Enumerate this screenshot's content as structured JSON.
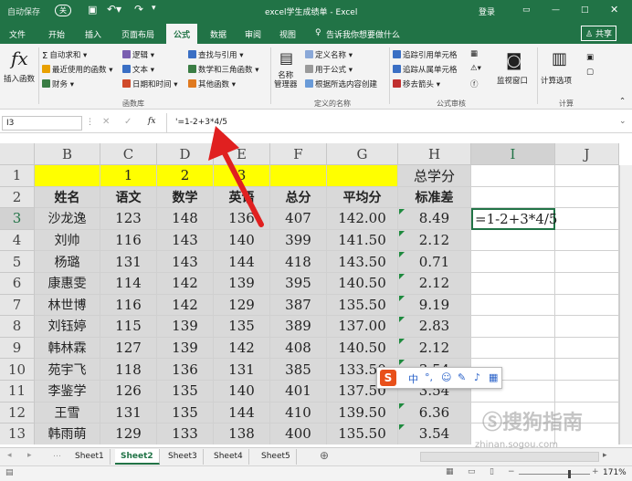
{
  "titlebar": {
    "autosave": "自动保存",
    "autosave_state": "关",
    "title": "excel学生成绩单 - Excel",
    "login": "登录"
  },
  "tabs": [
    "文件",
    "开始",
    "插入",
    "页面布局",
    "公式",
    "数据",
    "审阅",
    "视图"
  ],
  "active_tab_index": 4,
  "tell_me": "告诉我你想要做什么",
  "share": "共享",
  "ribbon": {
    "insert_function": "插入函数",
    "autosum": "自动求和",
    "recent": "最近使用的函数",
    "financial": "财务",
    "logical": "逻辑",
    "text": "文本",
    "datetime": "日期和时间",
    "lookup": "查找与引用",
    "math": "数学和三角函数",
    "other": "其他函数",
    "function_library": "函数库",
    "name_manager": "名称\n管理器",
    "define_name": "定义名称",
    "use_in_formula": "用于公式",
    "create_from_selection": "根据所选内容创建",
    "defined_names": "定义的名称",
    "trace_precedents": "追踪引用单元格",
    "trace_dependents": "追踪从属单元格",
    "remove_arrows": "移去箭头",
    "formula_auditing": "公式审核",
    "watch_window": "监视窗口",
    "calc_options": "计算选项",
    "calculation": "计算"
  },
  "formula_bar": {
    "name_box": "I3",
    "fx": "fx",
    "content": "'=1-2+3*4/5"
  },
  "columns": [
    "B",
    "C",
    "D",
    "E",
    "F",
    "G",
    "H",
    "I",
    "J"
  ],
  "rows": [
    "1",
    "2",
    "3",
    "4",
    "5",
    "6",
    "7",
    "8",
    "9",
    "10",
    "11",
    "12",
    "13"
  ],
  "row1": [
    "",
    "1",
    "2",
    "3",
    "",
    "",
    "总学分"
  ],
  "headers": [
    "姓名",
    "语文",
    "数学",
    "英语",
    "总分",
    "平均分",
    "标准差"
  ],
  "students": [
    [
      "沙龙逸",
      "123",
      "148",
      "136",
      "407",
      "142.00",
      "8.49"
    ],
    [
      "刘帅",
      "116",
      "143",
      "140",
      "399",
      "141.50",
      "2.12"
    ],
    [
      "杨璐",
      "131",
      "143",
      "144",
      "418",
      "143.50",
      "0.71"
    ],
    [
      "康惠雯",
      "114",
      "142",
      "139",
      "395",
      "140.50",
      "2.12"
    ],
    [
      "林世博",
      "116",
      "142",
      "129",
      "387",
      "135.50",
      "9.19"
    ],
    [
      "刘钰婷",
      "115",
      "139",
      "135",
      "389",
      "137.00",
      "2.83"
    ],
    [
      "韩林霖",
      "127",
      "139",
      "142",
      "408",
      "140.50",
      "2.12"
    ],
    [
      "苑宇飞",
      "118",
      "136",
      "131",
      "385",
      "133.50",
      "3.54"
    ],
    [
      "李鉴学",
      "126",
      "135",
      "140",
      "401",
      "137.50",
      "3.54"
    ],
    [
      "王雪",
      "131",
      "135",
      "144",
      "410",
      "139.50",
      "6.36"
    ],
    [
      "韩雨萌",
      "129",
      "133",
      "138",
      "400",
      "135.50",
      "3.54"
    ]
  ],
  "active_cell": {
    "text": "=1-2+3*4/5"
  },
  "sheets": [
    "Sheet1",
    "Sheet2",
    "Sheet3",
    "Sheet4",
    "Sheet5"
  ],
  "active_sheet_index": 1,
  "zoom": "171%",
  "ime": {
    "logo": "S",
    "lang": "中"
  },
  "watermark": {
    "site": "搜狗指南",
    "url": "zhinan.sogou.com"
  },
  "colors": {
    "excel_green": "#217346",
    "yellow": "#ffff00",
    "gray_fill": "#d9d9d9",
    "arrow": "#e02020"
  }
}
